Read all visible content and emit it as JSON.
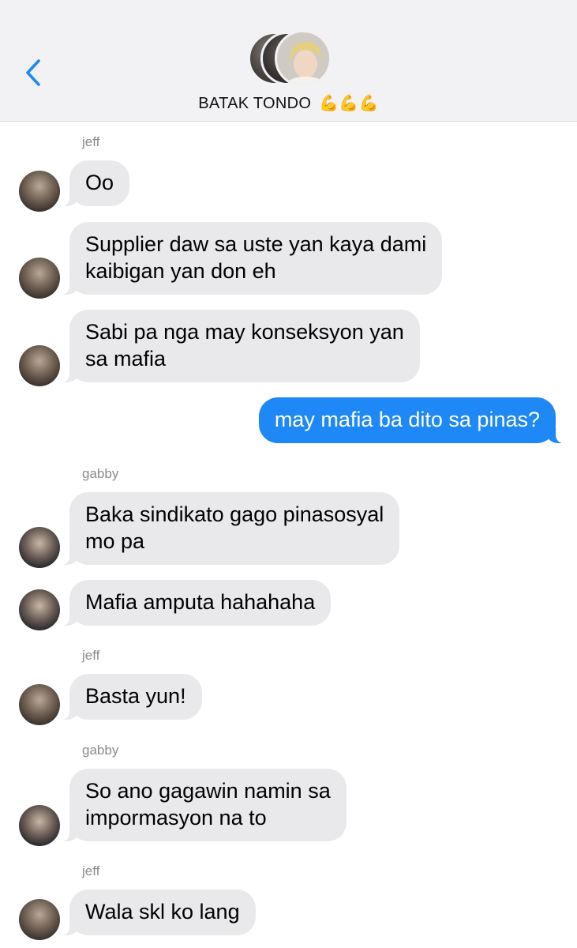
{
  "header": {
    "title": "BATAK TONDO",
    "title_emoji": "💪💪💪",
    "back_icon": "chevron-left-icon"
  },
  "colors": {
    "accent": "#1e88f6",
    "incoming_bubble": "#e9e9eb",
    "header_bg": "#f2f2f4",
    "sender_label": "#8a8a8e"
  },
  "messages": [
    {
      "sender_label": "jeff"
    },
    {
      "text": "Oo",
      "from": "jeff"
    },
    {
      "text": "Supplier daw sa uste yan kaya dami\nkaibigan yan don eh",
      "from": "jeff"
    },
    {
      "text": "Sabi pa nga may konseksyon yan\nsa mafia",
      "from": "jeff"
    },
    {
      "text": "may mafia ba dito sa pinas?",
      "from": "me"
    },
    {
      "sender_label": "gabby"
    },
    {
      "text": "Baka sindikato gago pinasosyal\nmo pa",
      "from": "gabby"
    },
    {
      "text": "Mafia amputa hahahaha",
      "from": "gabby"
    },
    {
      "sender_label": "jeff"
    },
    {
      "text": "Basta yun!",
      "from": "jeff"
    },
    {
      "sender_label": "gabby"
    },
    {
      "text": "So ano gagawin namin sa\nimpormasyon na to",
      "from": "gabby"
    },
    {
      "sender_label": "jeff"
    },
    {
      "text": "Wala skl ko lang",
      "from": "jeff"
    }
  ]
}
